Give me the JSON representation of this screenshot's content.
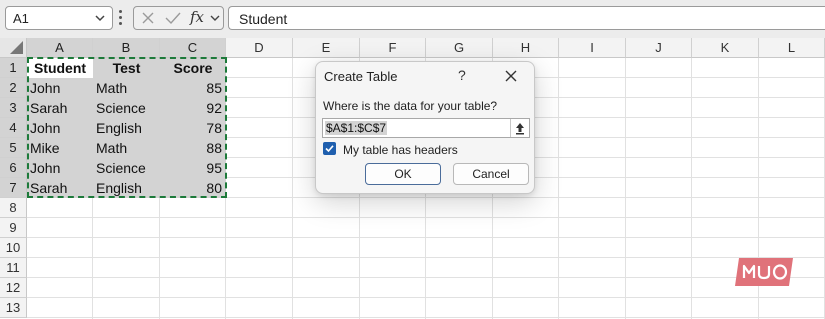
{
  "formula_bar": {
    "name_box": "A1",
    "fx_label": "fx",
    "formula": "Student"
  },
  "grid": {
    "columns": [
      "A",
      "B",
      "C",
      "D",
      "E",
      "F",
      "G",
      "H",
      "I",
      "J",
      "K",
      "L"
    ],
    "rows": [
      "1",
      "2",
      "3",
      "4",
      "5",
      "6",
      "7",
      "8",
      "9",
      "10",
      "11",
      "12",
      "13"
    ],
    "headers": [
      "Student",
      "Test",
      "Score"
    ],
    "data": [
      [
        "John",
        "Math",
        "85"
      ],
      [
        "Sarah",
        "Science",
        "92"
      ],
      [
        "John",
        "English",
        "78"
      ],
      [
        "Mike",
        "Math",
        "88"
      ],
      [
        "John",
        "Science",
        "95"
      ],
      [
        "Sarah",
        "English",
        "80"
      ]
    ]
  },
  "dialog": {
    "title": "Create Table",
    "help": "?",
    "prompt": "Where is the data for your table?",
    "range": "$A$1:$C$7",
    "headers_checkbox": "My table has headers",
    "headers_checked": true,
    "ok": "OK",
    "cancel": "Cancel"
  },
  "watermark": {
    "brand_color": "#e0727a"
  },
  "colors": {
    "selection": "#d3d3d3",
    "marquee": "#1d7a3a",
    "checkbox": "#1f5fae"
  }
}
